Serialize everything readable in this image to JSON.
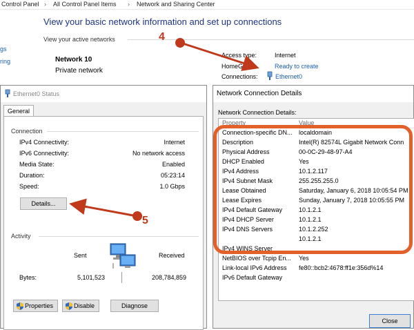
{
  "breadcrumb": [
    "Control Panel",
    "All Control Panel Items",
    "Network and Sharing Center"
  ],
  "control_panel": {
    "title": "View your basic network information and set up connections",
    "active_networks_label": "View your active networks",
    "left_links": [
      "gs",
      "ring"
    ],
    "network_name": "Network  10",
    "network_type": "Private network",
    "access_type_label": "Access type:",
    "access_type_value": "Internet",
    "homegroup_label": "HomeGr",
    "homegroup_link": "Ready to create",
    "connections_label": "Connections:",
    "connections_link": "Ethernet0"
  },
  "callouts": {
    "four": "4",
    "five": "5"
  },
  "status_window": {
    "title": "Ethernet0 Status",
    "tab": "General",
    "connection_group": "Connection",
    "rows": [
      {
        "label": "IPv4 Connectivity:",
        "value": "Internet"
      },
      {
        "label": "IPv6 Connectivity:",
        "value": "No network access"
      },
      {
        "label": "Media State:",
        "value": "Enabled"
      },
      {
        "label": "Duration:",
        "value": "05:23:14"
      },
      {
        "label": "Speed:",
        "value": "1.0 Gbps"
      }
    ],
    "details_button": "Details...",
    "activity_group": "Activity",
    "sent_label": "Sent",
    "received_label": "Received",
    "bytes_label": "Bytes:",
    "bytes_sent": "5,101,523",
    "bytes_received": "208,784,859",
    "properties_button": "Properties",
    "disable_button": "Disable",
    "diagnose_button": "Diagnose"
  },
  "details_window": {
    "title": "Network Connection Details",
    "list_label": "Network Connection Details:",
    "col_property": "Property",
    "col_value": "Value",
    "rows": [
      {
        "label": "Connection-specific DN...",
        "value": "localdomain"
      },
      {
        "label": "Description",
        "value": "Intel(R) 82574L Gigabit Network Conn"
      },
      {
        "label": "Physical Address",
        "value": "00-0C-29-48-97-A4"
      },
      {
        "label": "DHCP Enabled",
        "value": "Yes"
      },
      {
        "label": "IPv4 Address",
        "value": "10.1.2.117"
      },
      {
        "label": "IPv4 Subnet Mask",
        "value": "255.255.255.0"
      },
      {
        "label": "Lease Obtained",
        "value": "Saturday, January 6, 2018 10:05:54 PM"
      },
      {
        "label": "Lease Expires",
        "value": "Sunday, January 7, 2018 10:05:55 PM"
      },
      {
        "label": "IPv4 Default Gateway",
        "value": "10.1.2.1"
      },
      {
        "label": "IPv4 DHCP Server",
        "value": "10.1.2.1"
      },
      {
        "label": "IPv4 DNS Servers",
        "value": "10.1.2.252"
      },
      {
        "label": "",
        "value": "10.1.2.1"
      },
      {
        "label": "IPv4 WINS Server",
        "value": ""
      },
      {
        "label": "NetBIOS over Tcpip En...",
        "value": "Yes"
      },
      {
        "label": "Link-local IPv6 Address",
        "value": "fe80::bcb2:4678:ff1e:356d%14"
      },
      {
        "label": "IPv6 Default Gateway",
        "value": ""
      }
    ],
    "close_button": "Close"
  },
  "colors": {
    "highlight": "#e3602a",
    "callout": "#c0391b",
    "link": "#1a5fb4"
  }
}
